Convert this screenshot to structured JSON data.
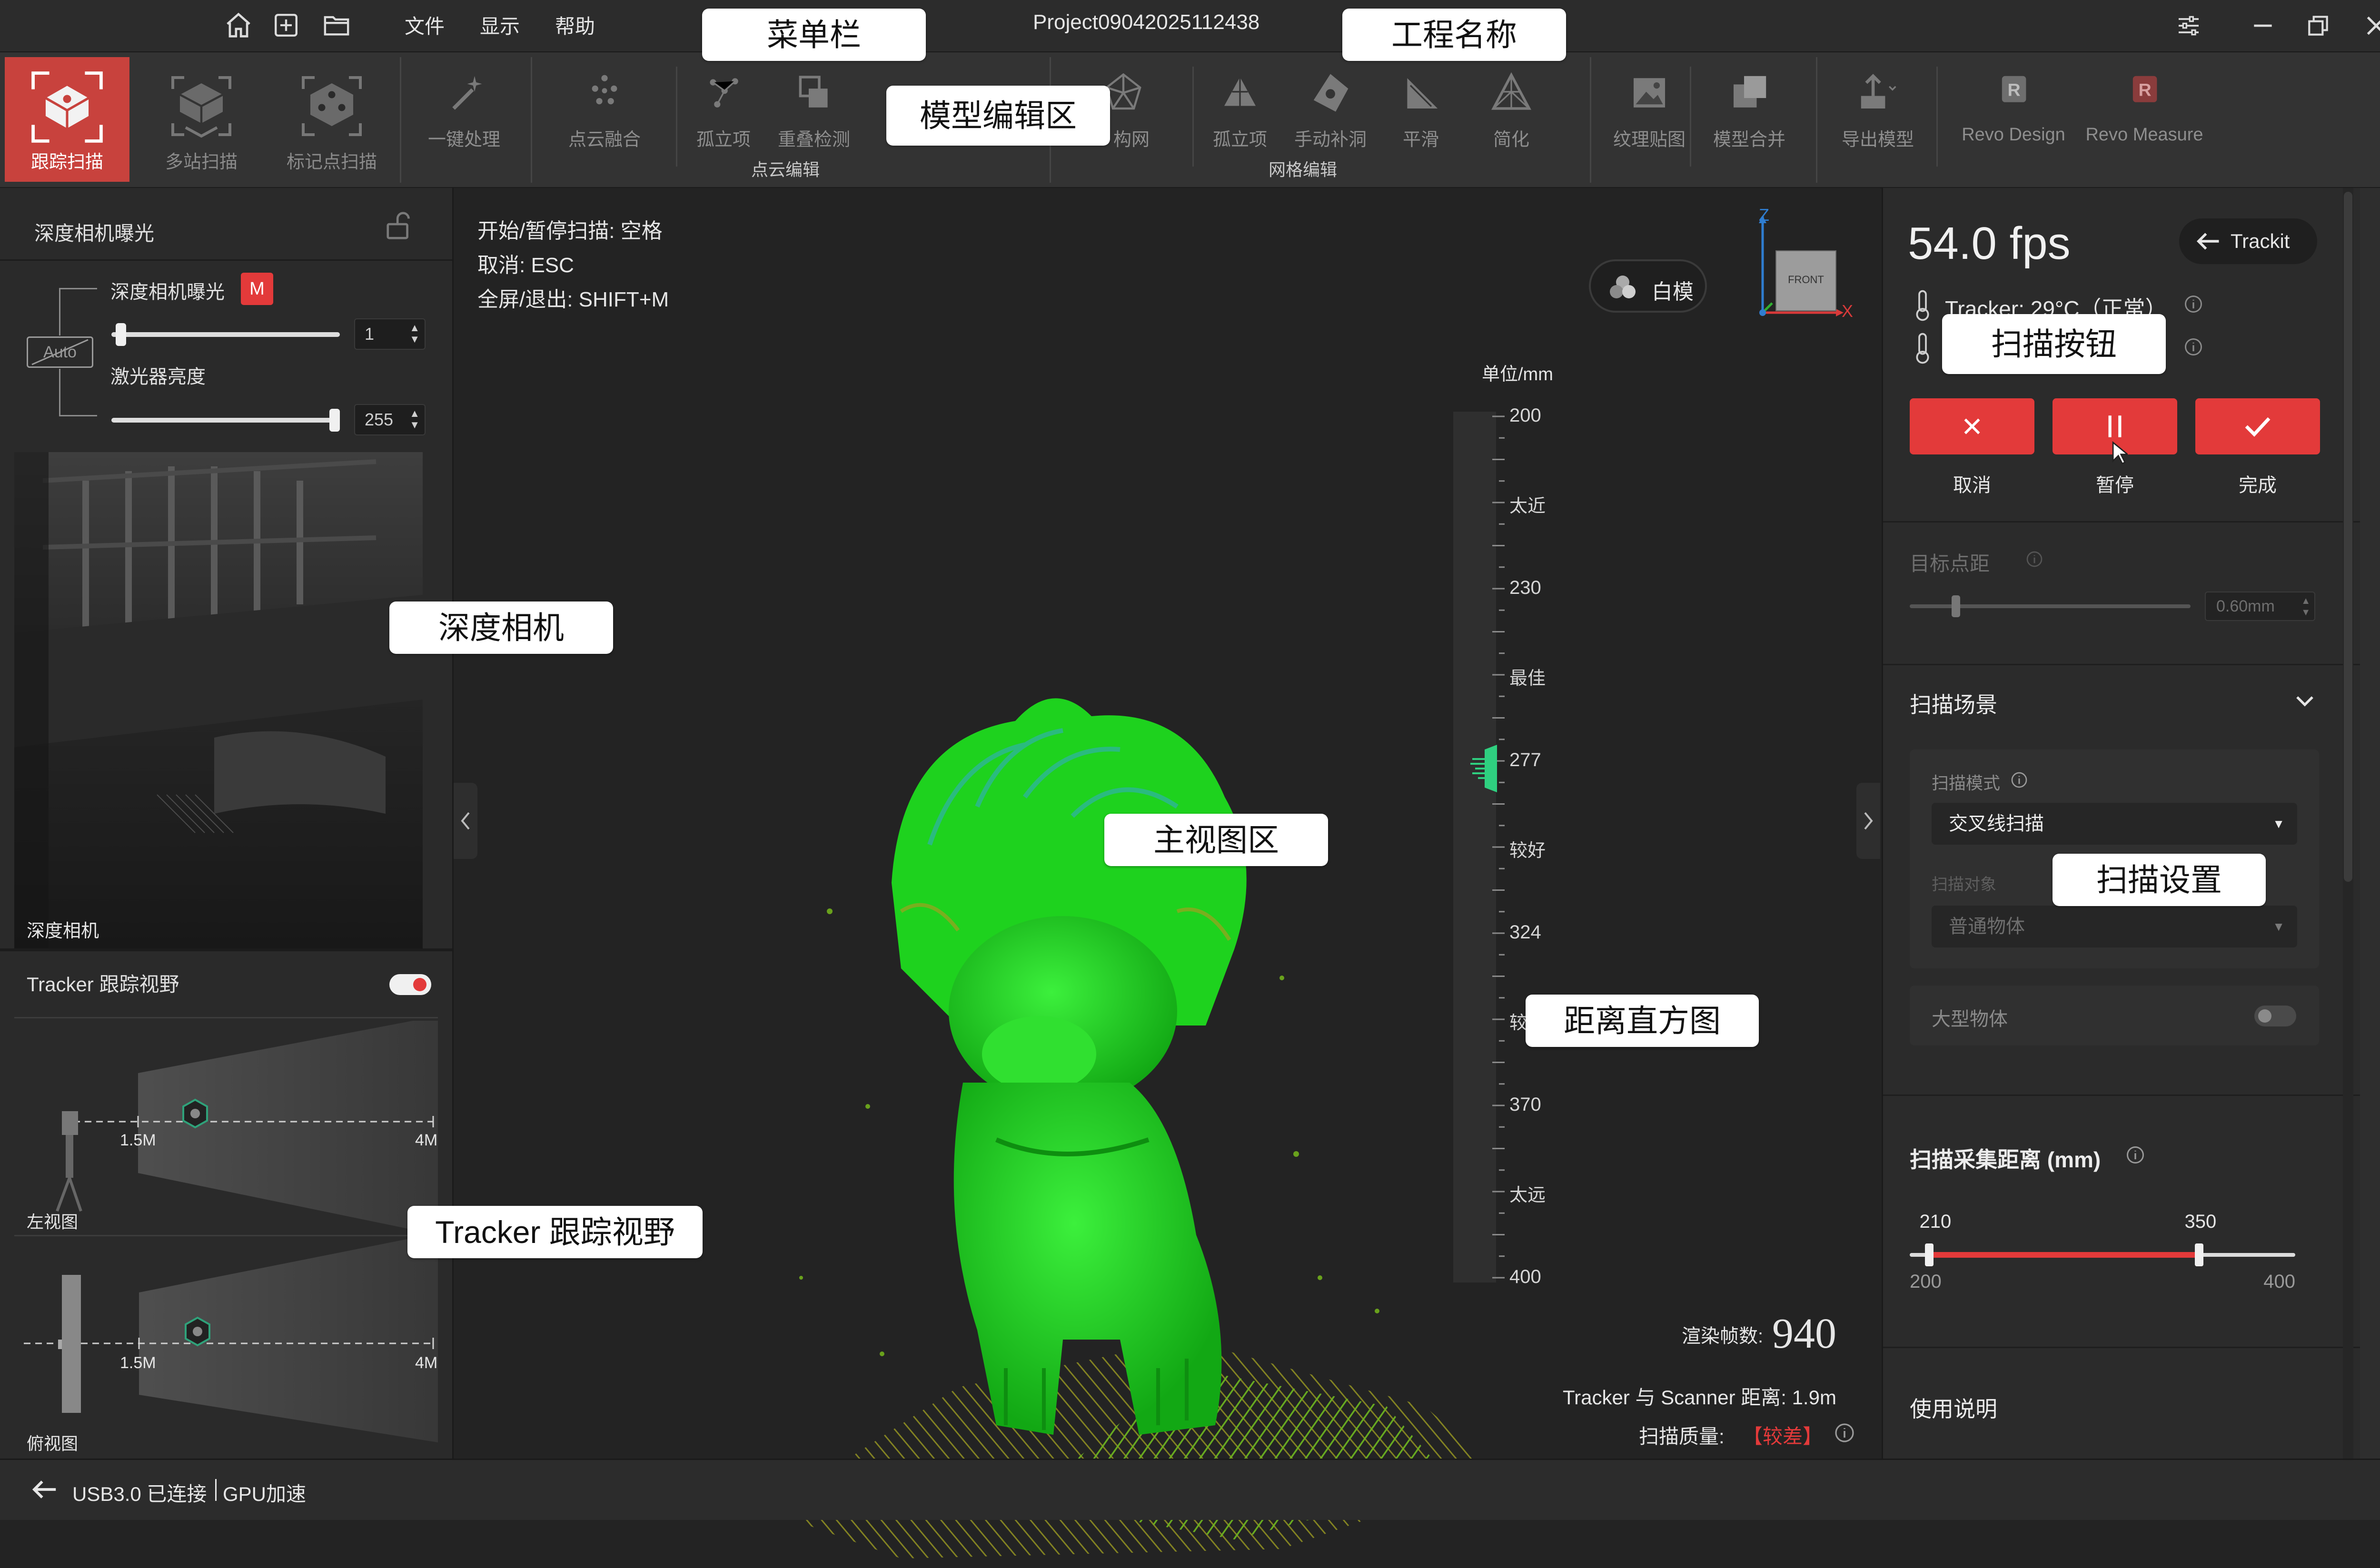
{
  "titlebar": {
    "menus": [
      "文件",
      "显示",
      "帮助"
    ],
    "project_name": "Project09042025112438"
  },
  "ribbon": {
    "modes": [
      {
        "label": "跟踪扫描",
        "active": true
      },
      {
        "label": "多站扫描",
        "active": false
      },
      {
        "label": "标记点扫描",
        "active": false
      }
    ],
    "one_click": "一键处理",
    "pointcloud_tools": [
      "点云融合",
      "孤立项",
      "重叠检测"
    ],
    "pointcloud_group": "点云编辑",
    "mesh_tools": [
      "构网",
      "孤立项",
      "手动补洞",
      "平滑",
      "简化"
    ],
    "mesh_group": "网格编辑",
    "texture": "纹理贴图",
    "merge": "模型合并",
    "export": "导出模型",
    "revo_design": "Revo Design",
    "revo_measure": "Revo Measure"
  },
  "left_panel": {
    "exposure_title": "深度相机曝光",
    "exposure_label": "深度相机曝光",
    "mode_badge": "M",
    "auto_label": "Auto",
    "exposure_value": "1",
    "exposure_level": 0.02,
    "laser_label": "激光器亮度",
    "laser_value": "255",
    "laser_level": 1.0,
    "depth_camera_caption": "深度相机",
    "tracker_title": "Tracker 跟踪视野",
    "tracker_toggle_on": true,
    "left_view_caption": "左视图",
    "top_view_caption": "俯视图",
    "dist_near": "1.5M",
    "dist_far": "4M"
  },
  "viewport": {
    "hints": [
      "开始/暂停扫描:  空格",
      "取消:  ESC",
      "全屏/退出:  SHIFT+M"
    ],
    "white_model": "白模",
    "cube_face": "FRONT",
    "axis_z": "Z",
    "axis_x": "X",
    "unit": "单位/mm",
    "histogram_ticks": [
      {
        "type": "num",
        "text": "200"
      },
      {
        "type": "lbl",
        "text": "太近"
      },
      {
        "type": "num",
        "text": "230"
      },
      {
        "type": "lbl",
        "text": "最佳"
      },
      {
        "type": "num",
        "text": "277"
      },
      {
        "type": "lbl",
        "text": "较好"
      },
      {
        "type": "num",
        "text": "324"
      },
      {
        "type": "lbl",
        "text": "较远"
      },
      {
        "type": "num",
        "text": "370"
      },
      {
        "type": "lbl",
        "text": "太远"
      },
      {
        "type": "num",
        "text": "400"
      }
    ],
    "render_frames_label": "渲染帧数:",
    "render_frames_value": "940",
    "distance_text": "Tracker 与 Scanner 距离:  1.9m",
    "quality_label": "扫描质量:",
    "quality_value": "【较差】"
  },
  "right_panel": {
    "fps": "54.0 fps",
    "trackit": "Trackit",
    "tracker_temp": "Tracker: 29°C（正常）",
    "cancel": "取消",
    "pause": "暂停",
    "finish": "完成",
    "point_distance_label": "目标点距",
    "point_distance_value": "0.60mm",
    "scene_title": "扫描场景",
    "scan_mode_label": "扫描模式",
    "scan_mode_value": "交叉线扫描",
    "scan_object_label": "扫描对象",
    "scan_object_value": "普通物体",
    "large_object": "大型物体",
    "distance_title": "扫描采集距离 (mm)",
    "range_low": "210",
    "range_high": "350",
    "range_min": "200",
    "range_max": "400",
    "usage": "使用说明"
  },
  "statusbar": {
    "connection": "USB3.0 已连接",
    "gpu": "GPU加速"
  },
  "callouts": {
    "menu_bar": "菜单栏",
    "project_name": "工程名称",
    "model_edit": "模型编辑区",
    "scan_button": "扫描按钮",
    "depth_camera": "深度相机",
    "main_view": "主视图区",
    "scan_settings": "扫描设置",
    "histogram": "距离直方图",
    "tracker_view": "Tracker 跟踪视野"
  },
  "colors": {
    "accent_red": "#e33a3a",
    "mode_active": "#c8423d",
    "point_cloud": "#19d21e"
  }
}
